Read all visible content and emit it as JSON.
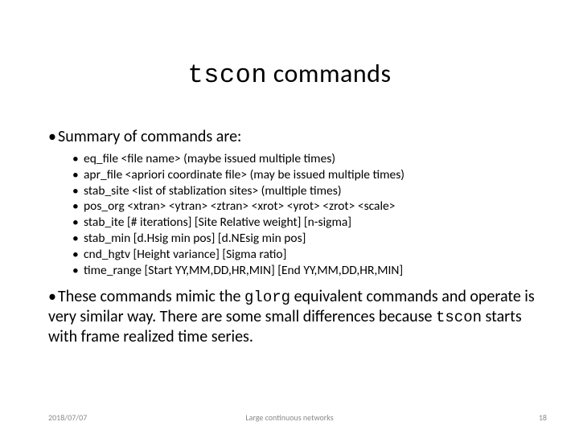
{
  "title": {
    "code": "tscon",
    "rest": " commands"
  },
  "summary_intro": "Summary of commands are:",
  "commands": [
    "eq_file <file name>  (maybe issued multiple times)",
    "apr_file <apriori coordinate file> (may be issued multiple times)",
    "stab_site <list of stablization sites> (multiple times)",
    "pos_org <xtran> <ytran> <ztran> <xrot> <yrot> <zrot> <scale>",
    "stab_ite [# iterations] [Site Relative weight] [n-sigma]",
    "stab_min [d.Hsig min pos] [d.NEsig min pos]",
    "cnd_hgtv [Height variance] [Sigma ratio]",
    "time_range [Start YY,MM,DD,HR,MIN] [End YY,MM,DD,HR,MIN]"
  ],
  "closing": {
    "pre": "These commands mimic the ",
    "code1": "glorg",
    "mid": " equivalent commands and operate is very similar way.  There are some small differences because ",
    "code2": "tscon",
    "post": " starts with frame realized time series."
  },
  "footer": {
    "date": "2018/07/07",
    "title": "Large continuous networks",
    "page": "18"
  }
}
